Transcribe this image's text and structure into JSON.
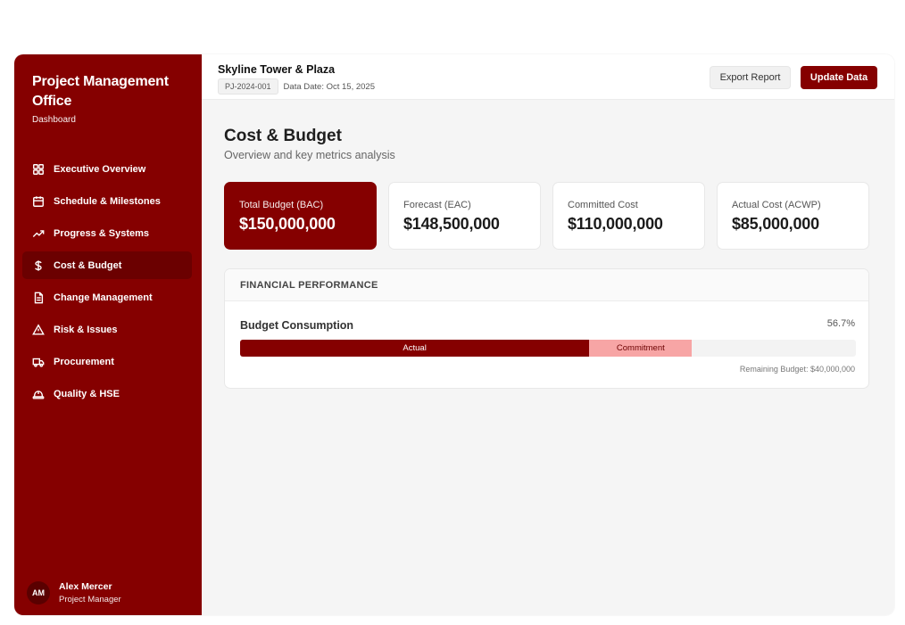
{
  "brand": {
    "title": "Project Management Office",
    "subtitle": "Dashboard"
  },
  "nav": {
    "items": [
      {
        "label": "Executive Overview",
        "icon": "grid-icon"
      },
      {
        "label": "Schedule & Milestones",
        "icon": "calendar-icon"
      },
      {
        "label": "Progress & Systems",
        "icon": "trending-up-icon"
      },
      {
        "label": "Cost & Budget",
        "icon": "dollar-icon",
        "active": true
      },
      {
        "label": "Change Management",
        "icon": "document-icon"
      },
      {
        "label": "Risk & Issues",
        "icon": "warning-icon"
      },
      {
        "label": "Procurement",
        "icon": "truck-icon"
      },
      {
        "label": "Quality & HSE",
        "icon": "hardhat-icon"
      }
    ]
  },
  "user": {
    "initials": "AM",
    "name": "Alex Mercer",
    "role": "Project Manager"
  },
  "header": {
    "project_name": "Skyline Tower & Plaza",
    "project_id": "PJ-2024-001",
    "data_date": "Data Date: Oct 15, 2025",
    "export_label": "Export Report",
    "update_label": "Update Data"
  },
  "page": {
    "title": "Cost & Budget",
    "subtitle": "Overview and key metrics analysis"
  },
  "kpis": [
    {
      "label": "Total Budget (BAC)",
      "value": "$150,000,000"
    },
    {
      "label": "Forecast (EAC)",
      "value": "$148,500,000"
    },
    {
      "label": "Committed Cost",
      "value": "$110,000,000"
    },
    {
      "label": "Actual Cost (ACWP)",
      "value": "$85,000,000"
    }
  ],
  "financial": {
    "header": "FINANCIAL PERFORMANCE",
    "metric_title": "Budget Consumption",
    "percent": "56.7%",
    "actual_label": "Actual",
    "commitment_label": "Commitment",
    "actual_fraction": 0.567,
    "commitment_fraction": 0.167,
    "remaining": "Remaining Budget: $40,000,000"
  },
  "colors": {
    "brand": "#850000",
    "brand_dark": "#6b0000",
    "commitment": "#f7a5a5"
  }
}
